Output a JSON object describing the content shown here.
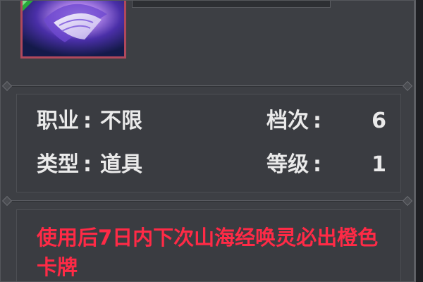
{
  "item": {
    "icon_name": "purple-scroll-card-icon",
    "frame_color": "#b0485c",
    "corner_badge_color": "#27a83a"
  },
  "stats": {
    "profession_label": "职业",
    "profession_value": "不限",
    "type_label": "类型",
    "type_value": "道具",
    "tier_label": "档次",
    "tier_value": "6",
    "level_label": "等级",
    "level_value": "1",
    "separator": ":"
  },
  "description": {
    "text": "使用后7日内下次山海经唤灵必出橙色卡牌",
    "color": "#ff2a46"
  }
}
